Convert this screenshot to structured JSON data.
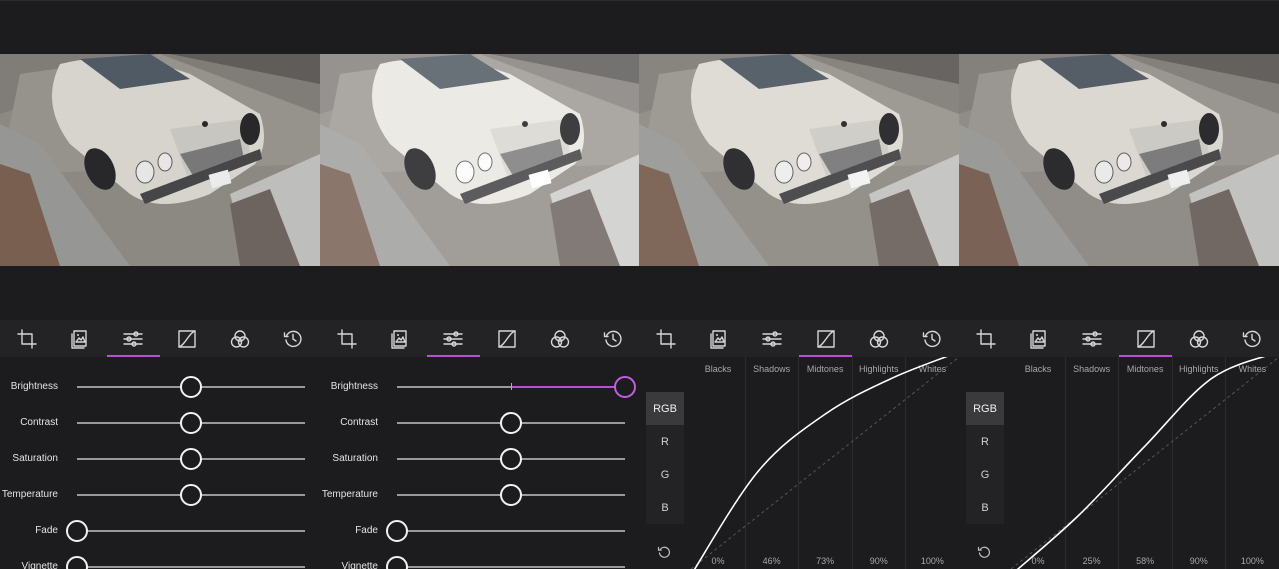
{
  "panels": [
    {
      "mode": "adjust",
      "active_tool": 2,
      "sliders": [
        {
          "label": "Brightness",
          "value": 0.5
        },
        {
          "label": "Contrast",
          "value": 0.5
        },
        {
          "label": "Saturation",
          "value": 0.5
        },
        {
          "label": "Temperature",
          "value": 0.5
        },
        {
          "label": "Fade",
          "value": 0.0
        },
        {
          "label": "Vignette",
          "value": 0.0
        }
      ]
    },
    {
      "mode": "adjust",
      "active_tool": 2,
      "sliders": [
        {
          "label": "Brightness",
          "value": 1.0,
          "highlight": true
        },
        {
          "label": "Contrast",
          "value": 0.5
        },
        {
          "label": "Saturation",
          "value": 0.5
        },
        {
          "label": "Temperature",
          "value": 0.5
        },
        {
          "label": "Fade",
          "value": 0.0
        },
        {
          "label": "Vignette",
          "value": 0.0
        }
      ]
    },
    {
      "mode": "curves",
      "active_tool": 3,
      "channels": [
        "RGB",
        "R",
        "G",
        "B"
      ],
      "active_channel": "RGB",
      "zones": [
        "Blacks",
        "Shadows",
        "Midtones",
        "Highlights",
        "Whites"
      ],
      "values": [
        "0%",
        "46%",
        "73%",
        "90%",
        "100%"
      ]
    },
    {
      "mode": "curves",
      "active_tool": 3,
      "channels": [
        "RGB",
        "R",
        "G",
        "B"
      ],
      "active_channel": "RGB",
      "zones": [
        "Blacks",
        "Shadows",
        "Midtones",
        "Highlights",
        "Whites"
      ],
      "values": [
        "0%",
        "25%",
        "58%",
        "90%",
        "100%"
      ]
    }
  ],
  "tools": [
    {
      "icon": "crop-icon"
    },
    {
      "icon": "filters-icon"
    },
    {
      "icon": "sliders-icon"
    },
    {
      "icon": "curves-icon"
    },
    {
      "icon": "color-circles-icon"
    },
    {
      "icon": "history-icon"
    }
  ],
  "colors": {
    "accent": "#b94fd6",
    "background": "#1c1c1e",
    "toolbar": "#232325"
  }
}
